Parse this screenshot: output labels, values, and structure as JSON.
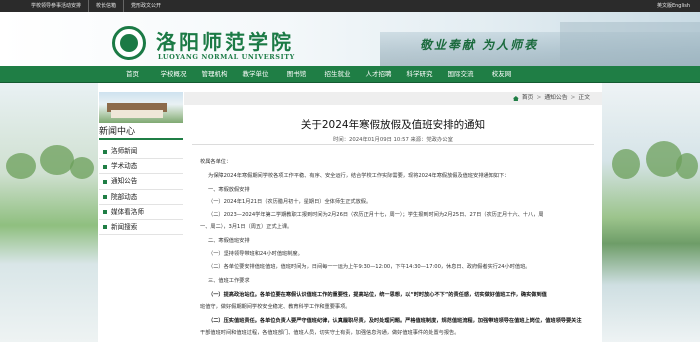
{
  "topbar": {
    "left_links": [
      "学校领导参事活动安排",
      "校长信箱",
      "党形政文公开"
    ],
    "right_link": "英文版English"
  },
  "header": {
    "logo_cn": "洛阳师范学院",
    "logo_en": "LUOYANG NORMAL UNIVERSITY",
    "motto": "敬业奉献   为人师表"
  },
  "nav": {
    "items": [
      "首页",
      "学校概况",
      "管理机构",
      "教学单位",
      "图书馆",
      "招生就业",
      "人才招聘",
      "科学研究",
      "国际交流",
      "校友网"
    ]
  },
  "sidebar": {
    "title": "新闻中心",
    "items": [
      "洛师新闻",
      "学术动态",
      "通知公告",
      "院部动态",
      "媒体看洛师",
      "新闻搜索"
    ]
  },
  "breadcrumb": {
    "home": "首页",
    "section": "通知公告",
    "current": "正文"
  },
  "article": {
    "title": "关于2024年寒假放假及值班安排的通知",
    "meta": "时间：2024年01月09日 10:57  来源：党政办公室",
    "paragraphs": [
      "校属各单位：",
      "为保障2024年寒假期间学校各项工作平稳、有序、安全运行，结合学校工作实际需要，现将2024年寒假放假及值班安排通知如下：",
      "一、寒假放假安排",
      "（一）2024年1月21日（农历腊月初十，星期日）全体师生正式放假。",
      "（二）2023—2024学年第二学期教职工报到时间为2月26日（农历正月十七，周一）；学生报到时间为2月25日、27日（农历正月十六、十八，周",
      "一、周二），3月1日（周五）正式上课。",
      "二、寒假值班安排",
      "（一）坚持领导带班和24小时值班制度。",
      "（二）各单位要安排值班值班，值班时间为，日间每一一运为上午9:30—12:00，下午14:30—17:00，休息日、政府假者实行24小时值班。",
      "三、值班工作要求",
      "（一）提高政治站位。各单位要在寒假认识值班工作的重要性，提高站位，统一思想，以“时时放心不下”的责任感，切实做好值班工作，确实做到值",
      "班值守，做好假期期间学校安全稳定、教育科学工作和重要事项。",
      "（二）压实值班责任。各单位负责人要严守值班纪律，认真履职尽责，及时处理问题。严格值班制度，规范值班流程，加强带班领导在值班上岗位，值班领导要关注",
      "干部值班时间和值班过程，各值班部门、值班人员，切实守土有责，加强信息沟通，做好值班事件的处置与报告。"
    ]
  },
  "colors": {
    "brand_green": "#1f7e45",
    "topbar": "#2b2b2b"
  }
}
